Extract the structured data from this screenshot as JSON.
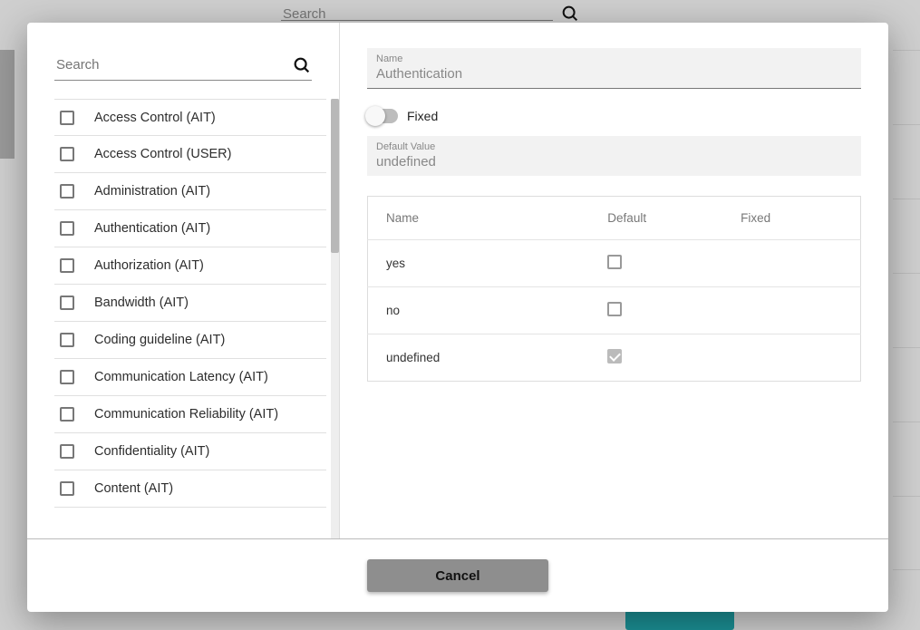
{
  "background": {
    "search_placeholder": "Search"
  },
  "modal": {
    "left": {
      "search_placeholder": "Search",
      "items": [
        {
          "label": "Access Control (AIT)"
        },
        {
          "label": "Access Control (USER)"
        },
        {
          "label": "Administration (AIT)"
        },
        {
          "label": "Authentication (AIT)"
        },
        {
          "label": "Authorization (AIT)"
        },
        {
          "label": "Bandwidth (AIT)"
        },
        {
          "label": "Coding guideline (AIT)"
        },
        {
          "label": "Communication Latency (AIT)"
        },
        {
          "label": "Communication Reliability (AIT)"
        },
        {
          "label": "Confidentiality (AIT)"
        },
        {
          "label": "Content (AIT)"
        }
      ]
    },
    "right": {
      "name_label": "Name",
      "name_value": "Authentication",
      "fixed_label": "Fixed",
      "default_value_label": "Default Value",
      "default_value_value": "undefined",
      "table": {
        "headers": {
          "name": "Name",
          "default": "Default",
          "fixed": "Fixed"
        },
        "rows": [
          {
            "name": "yes",
            "default_checked": false
          },
          {
            "name": "no",
            "default_checked": false
          },
          {
            "name": "undefined",
            "default_checked": true
          }
        ]
      }
    },
    "footer": {
      "cancel_label": "Cancel"
    }
  }
}
